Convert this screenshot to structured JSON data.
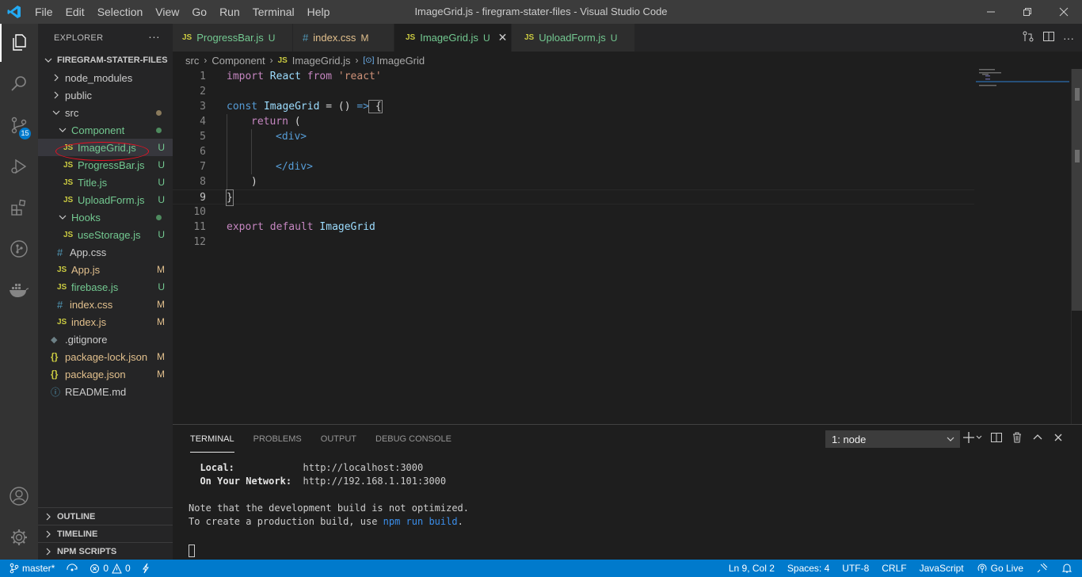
{
  "window": {
    "title": "ImageGrid.js - firegram-stater-files - Visual Studio Code",
    "menu": [
      "File",
      "Edit",
      "Selection",
      "View",
      "Go",
      "Run",
      "Terminal",
      "Help"
    ]
  },
  "activity_bar": {
    "scm_badge": "15",
    "icons": [
      "explorer-icon",
      "search-icon",
      "source-control-icon",
      "run-debug-icon",
      "extensions-icon",
      "git-graph-icon",
      "docker-icon",
      "accounts-icon",
      "settings-gear-icon"
    ]
  },
  "sidebar": {
    "header": "EXPLORER",
    "more_label": "···",
    "folder": "FIREGRAM-STATER-FILES",
    "tree": [
      {
        "label": "node_modules",
        "kind": "folder",
        "status": ""
      },
      {
        "label": "public",
        "kind": "folder",
        "status": ""
      },
      {
        "label": "src",
        "kind": "folder-open",
        "status": "dot"
      },
      {
        "label": "Component",
        "kind": "folder-open",
        "status": "dot"
      },
      {
        "label": "ImageGrid.js",
        "kind": "js",
        "status": "U"
      },
      {
        "label": "ProgressBar.js",
        "kind": "js",
        "status": "U"
      },
      {
        "label": "Title.js",
        "kind": "js",
        "status": "U"
      },
      {
        "label": "UploadForm.js",
        "kind": "js",
        "status": "U"
      },
      {
        "label": "Hooks",
        "kind": "folder-open",
        "status": "dot"
      },
      {
        "label": "useStorage.js",
        "kind": "js",
        "status": "U"
      },
      {
        "label": "App.css",
        "kind": "css",
        "status": ""
      },
      {
        "label": "App.js",
        "kind": "js",
        "status": "M"
      },
      {
        "label": "firebase.js",
        "kind": "js",
        "status": "U"
      },
      {
        "label": "index.css",
        "kind": "css",
        "status": "M"
      },
      {
        "label": "index.js",
        "kind": "js",
        "status": "M"
      },
      {
        "label": ".gitignore",
        "kind": "git",
        "status": ""
      },
      {
        "label": "package-lock.json",
        "kind": "json",
        "status": "M"
      },
      {
        "label": "package.json",
        "kind": "json",
        "status": "M"
      },
      {
        "label": "README.md",
        "kind": "info",
        "status": ""
      }
    ],
    "sections": [
      "OUTLINE",
      "TIMELINE",
      "NPM SCRIPTS"
    ]
  },
  "tabs": [
    {
      "label": "ProgressBar.js",
      "icon": "JS",
      "status": "U"
    },
    {
      "label": "index.css",
      "icon": "#",
      "status": "M"
    },
    {
      "label": "ImageGrid.js",
      "icon": "JS",
      "status": "U"
    },
    {
      "label": "UploadForm.js",
      "icon": "JS",
      "status": "U"
    }
  ],
  "breadcrumb": {
    "parts": [
      "src",
      "Component",
      "ImageGrid.js",
      "ImageGrid"
    ],
    "js_icon": "JS",
    "symbol_icon": "[⊙]"
  },
  "editor": {
    "line_numbers": [
      "1",
      "2",
      "3",
      "4",
      "5",
      "6",
      "7",
      "8",
      "9",
      "10",
      "11",
      "12"
    ],
    "current_line": "9",
    "tokens": {
      "l1": [
        "import",
        " React ",
        "from",
        " 'react'"
      ],
      "l3": [
        "const",
        " ImageGrid",
        " = () ",
        "=>",
        " {"
      ],
      "l4": [
        "return",
        " ("
      ],
      "l5": [
        "<div>"
      ],
      "l7": [
        "</div>"
      ],
      "l8": [
        ")"
      ],
      "l9": [
        "}"
      ],
      "l11": [
        "export",
        " default",
        " ImageGrid"
      ]
    }
  },
  "panel": {
    "tabs": [
      "TERMINAL",
      "PROBLEMS",
      "OUTPUT",
      "DEBUG CONSOLE"
    ],
    "terminal_select": "1: node",
    "terminal_lines": {
      "local_label": "Local:",
      "local_url": "http://localhost:3000",
      "network_label": "On Your Network:",
      "network_url": "http://192.168.1.101:3000",
      "note": "Note that the development build is not optimized.",
      "build_prefix": "To create a production build, use ",
      "build_cmd": "npm run build",
      "build_suffix": "."
    }
  },
  "statusbar": {
    "branch": "master*",
    "errors": "0",
    "warnings": "0",
    "position": "Ln 9, Col 2",
    "spaces": "Spaces: 4",
    "encoding": "UTF-8",
    "eol": "CRLF",
    "language": "JavaScript",
    "golive": "Go Live"
  },
  "colors": {
    "accent": "#007acc",
    "untracked": "#73c991",
    "modified": "#e2c08d",
    "annotation_circle": "#e81123"
  }
}
